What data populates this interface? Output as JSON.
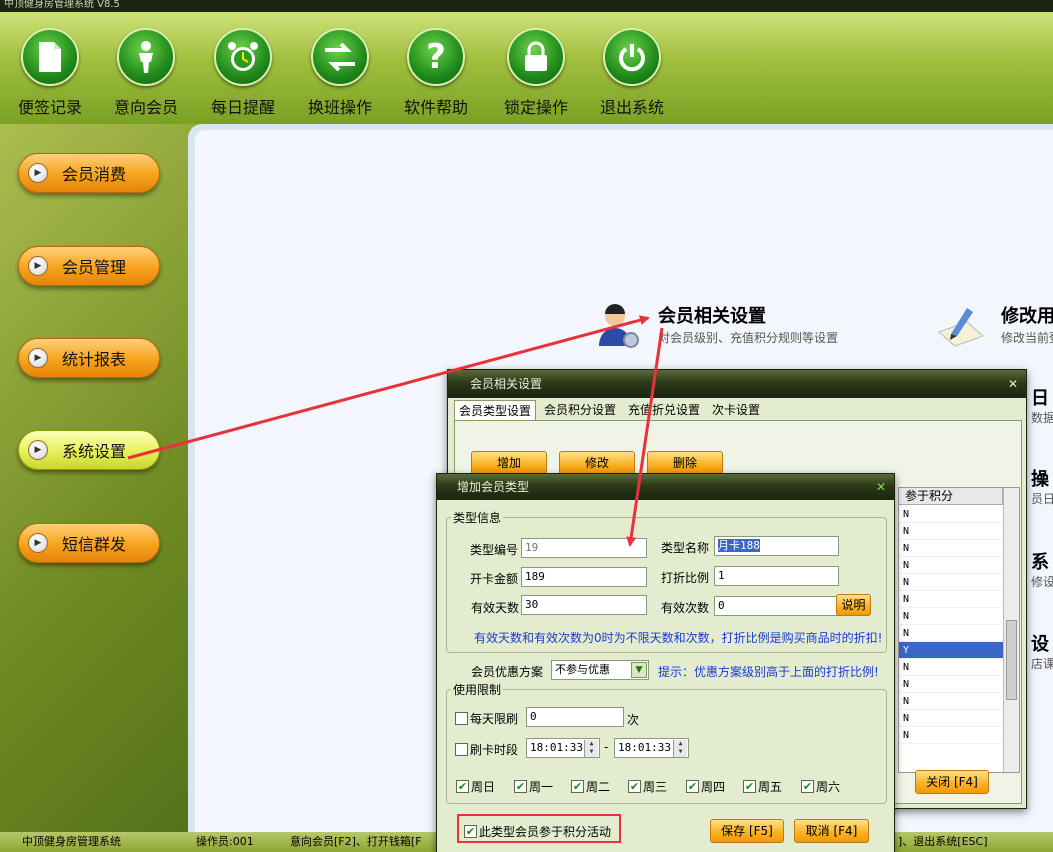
{
  "window": {
    "title": "中顶健身房管理系统  V8.5"
  },
  "toolbar": {
    "items": [
      {
        "label": "便签记录",
        "icon": "note-icon"
      },
      {
        "label": "意向会员",
        "icon": "person-icon"
      },
      {
        "label": "每日提醒",
        "icon": "alarm-clock-icon"
      },
      {
        "label": "换班操作",
        "icon": "swap-arrows-icon"
      },
      {
        "label": "软件帮助",
        "icon": "help-icon"
      },
      {
        "label": "锁定操作",
        "icon": "lock-icon"
      },
      {
        "label": "退出系统",
        "icon": "power-icon"
      }
    ]
  },
  "sidebar": {
    "items": [
      {
        "label": "会员消费"
      },
      {
        "label": "会员管理"
      },
      {
        "label": "统计报表"
      },
      {
        "label": "系统设置",
        "active": true
      },
      {
        "label": "短信群发"
      }
    ]
  },
  "workarea": {
    "modules": [
      {
        "title": "会员相关设置",
        "sub": "对会员级别、充值积分规则等设置",
        "icon": "member-settings-icon"
      },
      {
        "title": "修改用",
        "sub": "修改当前登",
        "icon": "edit-pen-icon"
      },
      {
        "title": "日",
        "sub": "数据相"
      },
      {
        "title": "操",
        "sub": "员日常"
      },
      {
        "title": "系",
        "sub": "修设"
      },
      {
        "title": "设",
        "sub": "店课表"
      }
    ]
  },
  "status": {
    "app": "中顶健身房管理系统",
    "operator": "操作员:001",
    "shortcuts": "意向会员[F2]、打开钱箱[F",
    "shortcuts_end": "]、退出系统[ESC]"
  },
  "dialog_member_settings": {
    "title": "会员相关设置",
    "tabs": [
      "会员类型设置",
      "会员积分设置",
      "充值折兑设置",
      "次卡设置"
    ],
    "buttons": {
      "add": "增加",
      "edit": "修改",
      "delete": "删除",
      "close": "关闭 [F4]"
    },
    "grid": {
      "header": "参于积分",
      "rows": [
        "N",
        "N",
        "N",
        "N",
        "N",
        "N",
        "N",
        "N",
        "Y",
        "N",
        "N",
        "N",
        "N",
        "N"
      ]
    }
  },
  "dialog_add_type": {
    "title": "增加会员类型",
    "group_info": "类型信息",
    "fields": {
      "type_no_label": "类型编号",
      "type_no": "19",
      "type_name_label": "类型名称",
      "type_name": "月卡188",
      "open_amount_label": "开卡金额",
      "open_amount": "189",
      "discount_label": "打折比例",
      "discount": "1",
      "valid_days_label": "有效天数",
      "valid_days": "30",
      "valid_count_label": "有效次数",
      "valid_count": "0",
      "explain_button": "说明"
    },
    "hint1": "有效天数和有效次数为0时为不限天数和次数，打折比例是购买商品时的折扣!",
    "discount_plan_label": "会员优惠方案",
    "discount_plan_value": "不参与优惠",
    "hint2": "提示：优惠方案级别高于上面的打折比例!",
    "group_limit": "使用限制",
    "daily_limit_label": "每天限刷",
    "daily_limit_value": "0",
    "daily_limit_unit": "次",
    "time_range_label": "刷卡时段",
    "time_start": "18:01:33",
    "time_sep": "-",
    "time_end": "18:01:33",
    "weekdays": [
      "周日",
      "周一",
      "周二",
      "周三",
      "周四",
      "周五",
      "周六"
    ],
    "points_checkbox": "此类型会员参于积分活动",
    "save_button": "保存 [F5]",
    "cancel_button": "取消 [F4]"
  },
  "colors": {
    "accent": "#f9b020",
    "annotation": "#e8313a",
    "hint": "#1a3ad0"
  }
}
